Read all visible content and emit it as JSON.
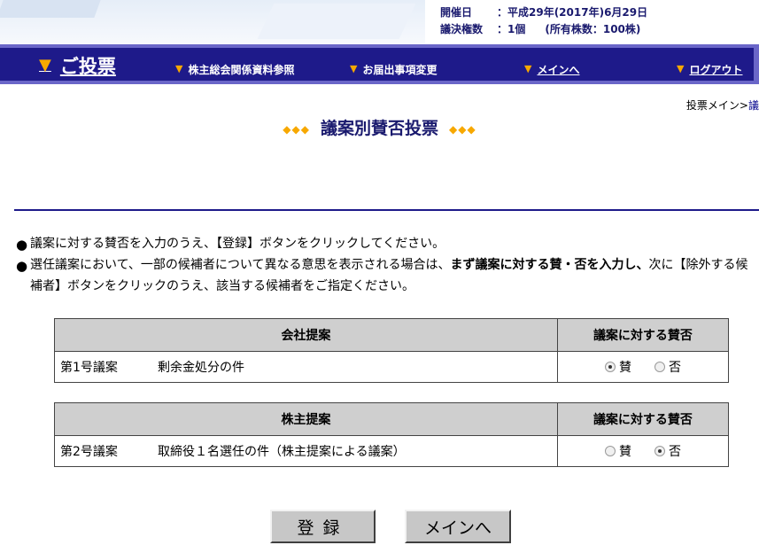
{
  "info": {
    "date_label": "開催日",
    "date_value": "：平成29年(2017年)6月29日",
    "votes_label": "議決権数",
    "votes_value": "：1個",
    "shares_text": "(所有株数：100株)"
  },
  "nav": {
    "title": "ご投票",
    "items": [
      {
        "label": "株主総会関係資料参照"
      },
      {
        "label": "お届出事項変更"
      },
      {
        "label": "メインへ"
      },
      {
        "label": "ログアウト"
      }
    ]
  },
  "breadcrumb": {
    "part1": "投票メイン>",
    "part2": "議"
  },
  "page_title": {
    "dots": "◆◆◆",
    "text": "議案別賛否投票"
  },
  "notes": {
    "note1": "議案に対する賛否を入力のうえ、【登録】ボタンをクリックしてください。",
    "note2_pre": "選任議案において、一部の候補者について異なる意思を表示される場合は、",
    "note2_bold": "まず議案に対する賛・否を入力し、",
    "note2_post": "次に【除外する候補者】ボタンをクリックのうえ、該当する候補者をご指定ください。"
  },
  "vote_header": "議案に対する賛否",
  "company": {
    "header": "会社提案",
    "rows": [
      {
        "num": "第1号議案",
        "title": "剰余金処分の件",
        "selected": "賛"
      }
    ]
  },
  "shareholder": {
    "header": "株主提案",
    "rows": [
      {
        "num": "第2号議案",
        "title": "取締役１名選任の件（株主提案による議案）",
        "selected": "否"
      }
    ]
  },
  "options": {
    "approve": "賛",
    "reject": "否"
  },
  "buttons": {
    "register": "登録",
    "main": "メインへ"
  }
}
